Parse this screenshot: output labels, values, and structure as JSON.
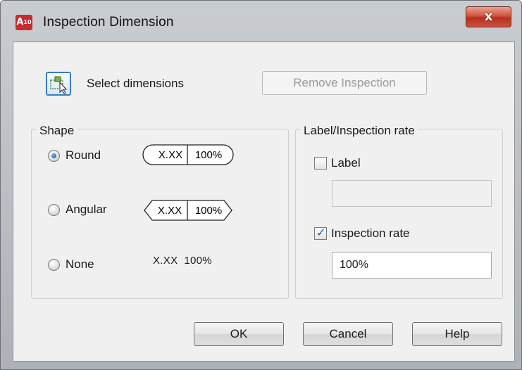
{
  "window": {
    "title": "Inspection Dimension",
    "app_icon_letter": "A",
    "app_icon_suffix": "10",
    "close_glyph": "x"
  },
  "toolbar": {
    "select_dimensions_label": "Select dimensions",
    "remove_inspection_label": "Remove Inspection"
  },
  "shape": {
    "legend": "Shape",
    "options": [
      {
        "label": "Round",
        "checked": true
      },
      {
        "label": "Angular",
        "checked": false
      },
      {
        "label": "None",
        "checked": false
      }
    ],
    "preview_value": "X.XX",
    "preview_rate": "100%",
    "none_preview": "X.XX  100%"
  },
  "label_rate": {
    "legend": "Label/Inspection rate",
    "label_checkbox": {
      "label": "Label",
      "checked": false
    },
    "label_value": "",
    "rate_checkbox": {
      "label": "Inspection rate",
      "checked": true
    },
    "rate_value": "100%"
  },
  "buttons": {
    "ok": "OK",
    "cancel": "Cancel",
    "help": "Help"
  },
  "colors": {
    "close_button": "#c9412c",
    "icon_red": "#c72b2b",
    "select_border": "#3b7bc1"
  }
}
